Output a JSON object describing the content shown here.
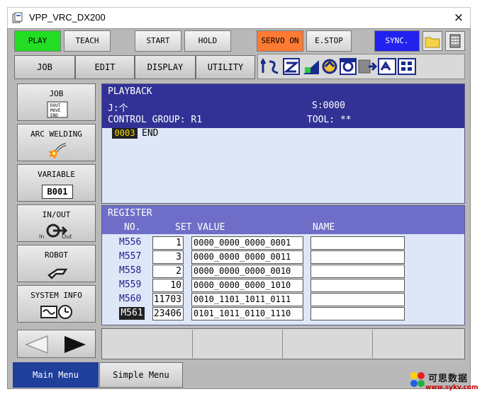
{
  "window": {
    "title": "VPP_VRC_DX200",
    "close_glyph": "×"
  },
  "mode_buttons": [
    {
      "label": "PLAY",
      "color": "#22dd22"
    },
    {
      "label": "TEACH"
    },
    {
      "label": "START"
    },
    {
      "label": "HOLD"
    },
    {
      "label": "SERVO ON",
      "color": "#ff7a33"
    },
    {
      "label": "E.STOP"
    },
    {
      "label": "SYNC.",
      "color": "#2222ee"
    }
  ],
  "menu_bar": [
    "JOB",
    "EDIT",
    "DISPLAY",
    "UTILITY"
  ],
  "sidebar": [
    {
      "label": "JOB",
      "icon": "job-doc-icon",
      "icon_text": "DOUT MOVE END"
    },
    {
      "label": "ARC WELDING",
      "icon": "welding-torch-icon"
    },
    {
      "label": "VARIABLE",
      "icon": "variable-box-icon",
      "icon_text": "B001"
    },
    {
      "label": "IN/OUT",
      "icon": "in-out-icon",
      "icon_text_in": "In",
      "icon_text_out": "Out"
    },
    {
      "label": "ROBOT",
      "icon": "robot-arm-icon"
    },
    {
      "label": "SYSTEM INFO",
      "icon": "system-info-icon"
    }
  ],
  "playback": {
    "title": "PLAYBACK",
    "job": "J:个",
    "step": "S:0000",
    "control_group": "CONTROL GROUP: R1",
    "tool": "TOOL: **",
    "line_number": "0003",
    "line_text": "END"
  },
  "register": {
    "title": "REGISTER",
    "col_no": "NO.",
    "col_set_value": "SET VALUE",
    "col_name": "NAME",
    "rows": [
      {
        "no": "M556",
        "set": "1",
        "value": "0000_0000_0000_0001",
        "name": ""
      },
      {
        "no": "M557",
        "set": "3",
        "value": "0000_0000_0000_0011",
        "name": ""
      },
      {
        "no": "M558",
        "set": "2",
        "value": "0000_0000_0000_0010",
        "name": ""
      },
      {
        "no": "M559",
        "set": "10",
        "value": "0000_0000_0000_1010",
        "name": ""
      },
      {
        "no": "M560",
        "set": "11703",
        "value": "0010_1101_1011_0111",
        "name": ""
      },
      {
        "no": "M561",
        "set": "23406",
        "value": "0101_1011_0110_1110",
        "name": "",
        "selected": true
      }
    ]
  },
  "bottom_menu": {
    "main": "Main Menu",
    "simple": "Simple Menu"
  },
  "watermark": {
    "text": "可思数据",
    "url": "www.sykv.com"
  }
}
